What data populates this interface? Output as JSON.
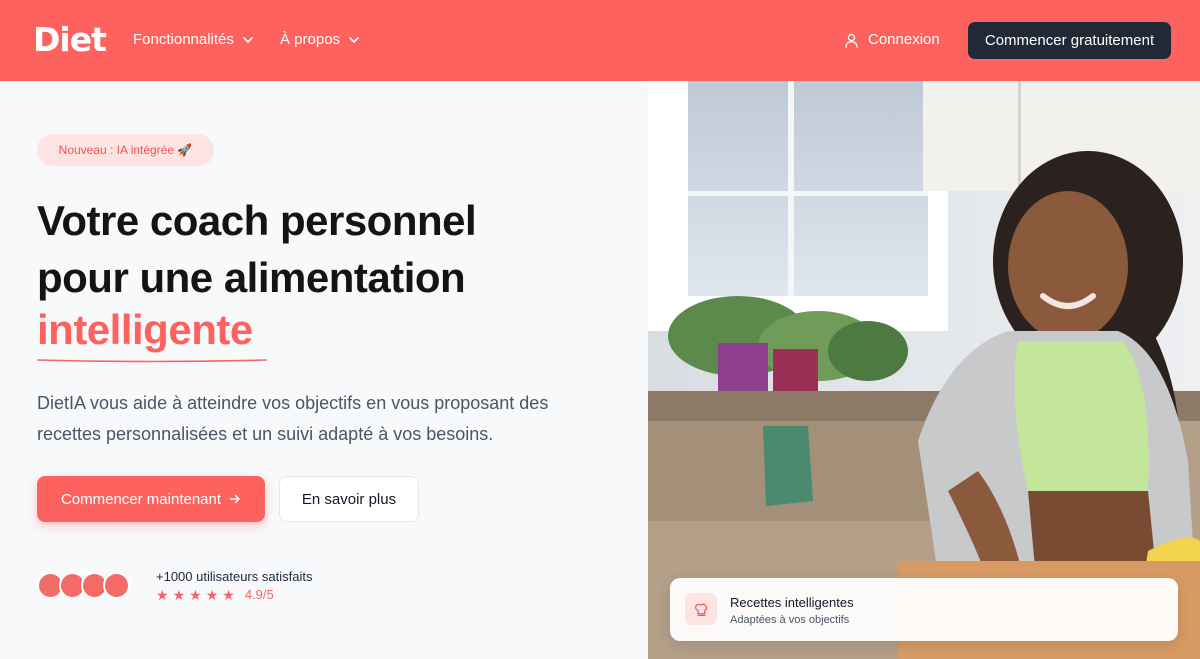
{
  "nav": {
    "logo": "Diet",
    "links": [
      {
        "label": "Fonctionnalités"
      },
      {
        "label": "À propos"
      }
    ],
    "login": "Connexion",
    "cta": "Commencer gratuitement"
  },
  "hero": {
    "badge": "Nouveau : IA intégrée 🚀",
    "headline_line1": "Votre coach personnel",
    "headline_line2": "pour une alimentation",
    "headline_accent": "intelligente",
    "description": "DietIA vous aide à atteindre vos objectifs en vous proposant des recettes personnalisées et un suivi adapté à vos besoins.",
    "primary_button": "Commencer maintenant",
    "secondary_button": "En savoir plus",
    "social_proof": "+1000 utilisateurs satisfaits",
    "star_count": 5,
    "rating": "4.9/5"
  },
  "card": {
    "title": "Recettes intelligentes",
    "subtitle": "Adaptées à vos objectifs"
  },
  "colors": {
    "brand": "#fe625f",
    "dark_button": "#212937",
    "badge_bg": "#fde4e3"
  }
}
